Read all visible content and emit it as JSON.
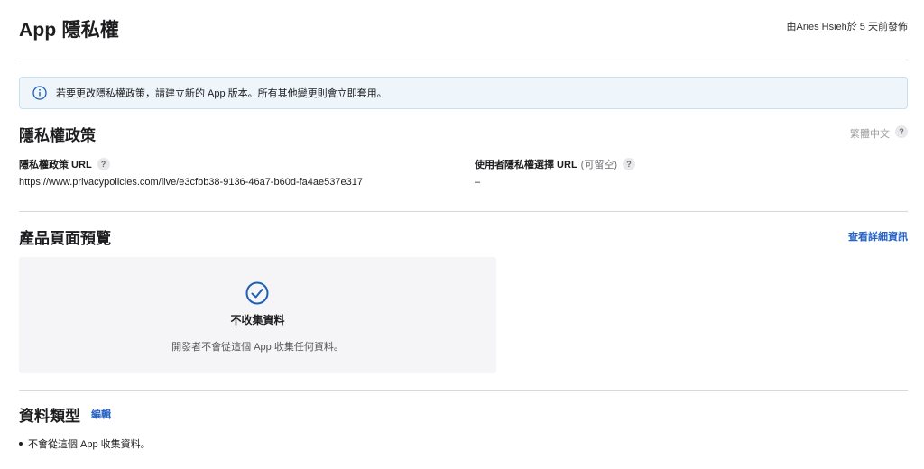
{
  "header": {
    "title": "App 隱私權",
    "publish_info": "由Aries Hsieh於 5 天前發佈"
  },
  "banner": {
    "icon": "info-icon",
    "text": "若要更改隱私權政策，請建立新的 App 版本。所有其他變更則會立即套用。"
  },
  "privacy_policy": {
    "title": "隱私權政策",
    "language": "繁體中文",
    "help": "?",
    "url_label": "隱私權政策 URL",
    "url_value": "https://www.privacypolicies.com/live/e3cfbb38-9136-46a7-b60d-fa4ae537e317",
    "choices_label": "使用者隱私權選擇 URL",
    "choices_optional": "(可留空)",
    "choices_value": "–"
  },
  "preview": {
    "title": "產品頁面預覽",
    "detail_link": "查看詳細資訊",
    "card_icon": "checkmark-circle-icon",
    "card_title": "不收集資料",
    "card_desc": "開發者不會從這個 App 收集任何資料。"
  },
  "data_types": {
    "title": "資料類型",
    "edit_link": "編輯",
    "items": [
      "不會從這個 App 收集資料。"
    ]
  },
  "colors": {
    "link": "#2462c5",
    "banner_bg": "#eef5fb",
    "card_bg": "#f5f5f7"
  }
}
